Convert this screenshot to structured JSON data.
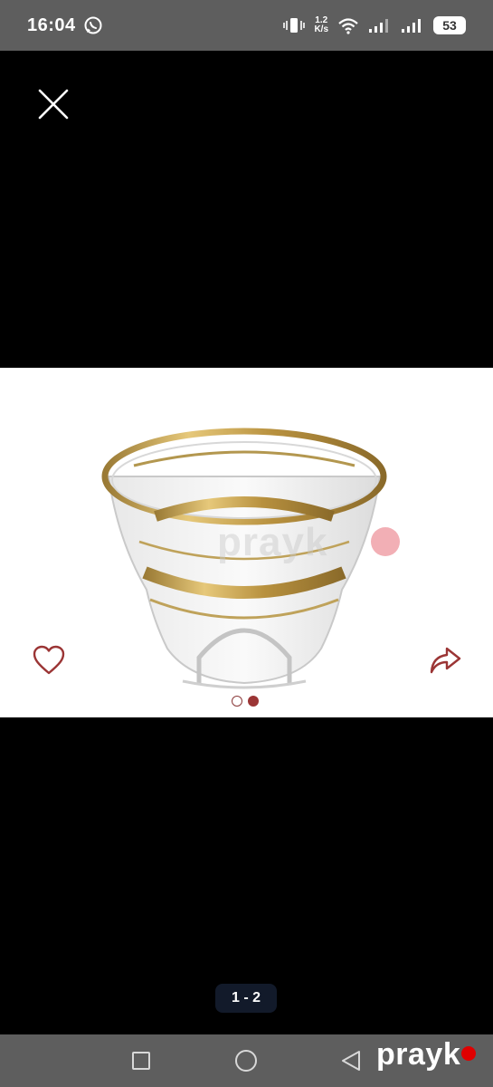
{
  "status_bar": {
    "time": "16:04",
    "speed_value": "1.2",
    "speed_unit": "K/s",
    "battery": "53",
    "icons": [
      "whatsapp-icon",
      "vibrate-icon",
      "wifi-icon",
      "signal-icon",
      "signal-icon",
      "battery-icon"
    ]
  },
  "viewer": {
    "close_icon": "close-icon",
    "favorite_icon": "heart-icon",
    "share_icon": "share-icon",
    "watermark": "prayk",
    "carousel": {
      "count": 2,
      "active_index": 1
    },
    "page_counter": "1 - 2"
  },
  "nav_bar": {
    "icons": [
      "recents-icon",
      "home-icon",
      "back-icon"
    ],
    "brand": "prayk"
  },
  "colors": {
    "accent": "#9b3535",
    "status_bar_bg": "#5e5e5e",
    "counter_bg": "#121a2a"
  }
}
